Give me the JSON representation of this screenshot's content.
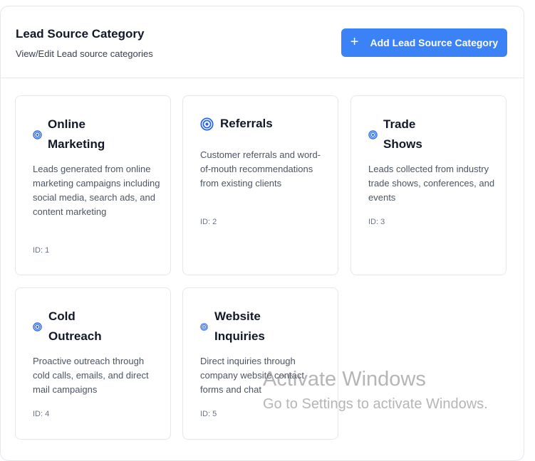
{
  "header": {
    "title": "Lead Source Category",
    "subtitle": "View/Edit Lead source categories",
    "add_button_label": "Add Lead Source Category",
    "add_button_icon": "plus-icon"
  },
  "cards": [
    {
      "icon": "target-icon",
      "title": "Online\nMarketing",
      "description": "Leads generated from online marketing campaigns including social media, search ads, and content marketing",
      "id_label": "ID: 1"
    },
    {
      "icon": "target-icon",
      "title": "Referrals",
      "description": "Customer referrals and word-of-mouth recommendations from existing clients",
      "id_label": "ID: 2"
    },
    {
      "icon": "target-icon",
      "title": "Trade\nShows",
      "description": "Leads collected from industry trade shows, conferences, and events",
      "id_label": "ID: 3"
    },
    {
      "icon": "target-icon",
      "title": "Cold\nOutreach",
      "description": "Proactive outreach through cold calls, emails, and direct mail campaigns",
      "id_label": "ID: 4"
    },
    {
      "icon": "target-icon",
      "title": "Website\nInquiries",
      "description": "Direct inquiries through company website contact forms and chat",
      "id_label": "ID: 5"
    }
  ],
  "watermark": {
    "line1": "Activate Windows",
    "line2": "Go to Settings to activate Windows."
  },
  "colors": {
    "accent": "#3b82f6",
    "icon": "#2563eb"
  }
}
